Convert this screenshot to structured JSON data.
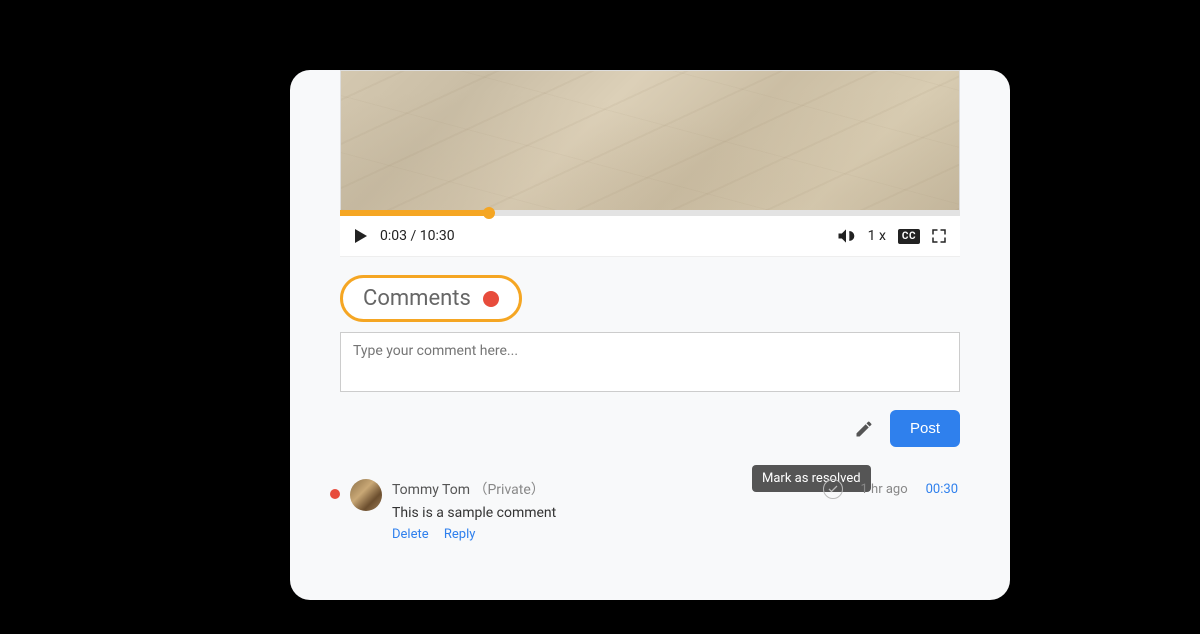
{
  "video": {
    "current_time": "0:03",
    "total_time": "10:30",
    "time_display": "0:03 / 10:30",
    "speed": "1 x",
    "cc_label": "CC",
    "progress_percent": 24
  },
  "comments": {
    "title": "Comments",
    "placeholder": "Type your comment here...",
    "post_label": "Post",
    "tooltip": "Mark as resolved"
  },
  "comment_item": {
    "author": "Tommy Tom",
    "privacy": "（Private）",
    "text": "This is a sample comment",
    "delete_label": "Delete",
    "reply_label": "Reply",
    "time_ago": "1 hr ago",
    "timestamp": "00:30"
  },
  "colors": {
    "accent_orange": "#f5a623",
    "red_dot": "#e74c3c",
    "blue": "#2f80ed"
  }
}
